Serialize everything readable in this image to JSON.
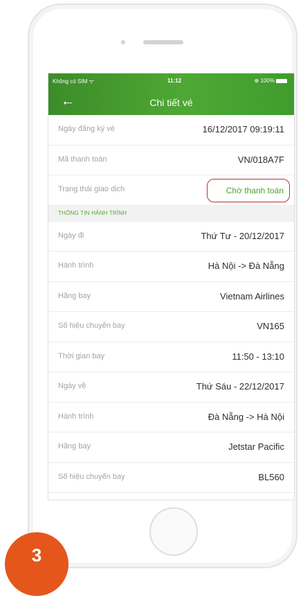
{
  "status_bar": {
    "carrier": "Không có SIM ᯤ",
    "time": "11:12",
    "battery": "⊕ 100%"
  },
  "header": {
    "back_icon": "←",
    "title": "Chi tiết vé"
  },
  "summary": [
    {
      "label": "Ngày đăng ký vé",
      "value": "16/12/2017 09:19:11"
    },
    {
      "label": "Mã thanh toán",
      "value": "VN/018A7F"
    }
  ],
  "transaction_status": {
    "label": "Trạng thái giao dịch",
    "value": "Chờ thanh toán"
  },
  "section_title": "THÔNG TIN HÀNH TRÌNH",
  "itinerary": [
    {
      "label": "Ngày đi",
      "value": "Thứ Tư - 20/12/2017"
    },
    {
      "label": "Hành trình",
      "value": "Hà Nội -> Đà Nẵng"
    },
    {
      "label": "Hãng bay",
      "value": "Vietnam Airlines"
    },
    {
      "label": "Số hiệu chuyến bay",
      "value": "VN165"
    },
    {
      "label": "Thời gian bay",
      "value": "11:50 - 13:10"
    },
    {
      "label": "Ngày về",
      "value": "Thứ Sáu - 22/12/2017"
    },
    {
      "label": "Hành trình",
      "value": "Đà Nẵng -> Hà Nội"
    },
    {
      "label": "Hãng bay",
      "value": "Jetstar Pacific"
    },
    {
      "label": "Số hiệu chuyến bay",
      "value": "BL560"
    }
  ],
  "step_badge": "3",
  "colors": {
    "header_green": "#4ea834",
    "status_outline": "#b63333",
    "badge_orange": "#e5561c"
  }
}
